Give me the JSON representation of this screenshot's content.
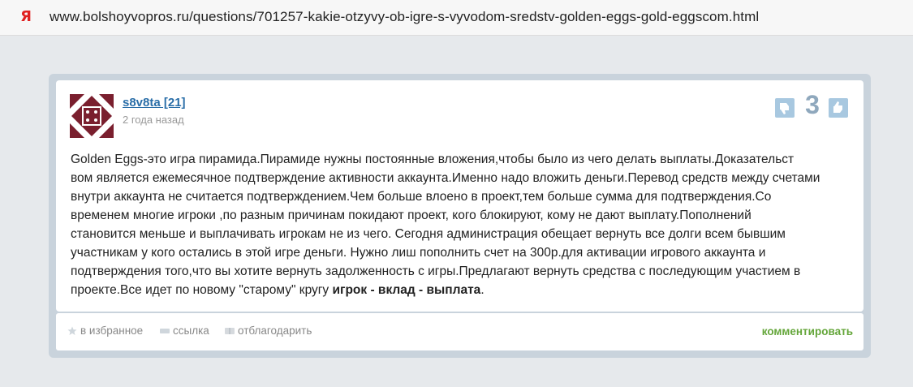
{
  "browser": {
    "url": "www.bolshoyvopros.ru/questions/701257-kakie-otzyvy-ob-igre-s-vyvodom-sredstv-golden-eggs-gold-eggscom.html",
    "favicon": "yandex-icon"
  },
  "answer": {
    "username": "s8v8ta [21]",
    "time": "2 года назад",
    "votes": "3",
    "lines": [
      "Golden Eggs-это игра пирамида.Пирамиде нужны постоянные вложения,чтобы было из чего делать выплаты.Доказательст",
      "вом является ежемесячное подтверждение активности аккаунта.Именно надо вложить деньги.Перевод средств между счетами",
      "внутри аккаунта не считается подтверждением.Чем больше влоено в проект,тем больше сумма для подтверждения.Со",
      "временем многие игроки ,по разным причинам покидают проект, кого блокируют, кому не дают выплату.Пополнений",
      "становится меньше и выплачивать игрокам не из чего. Сегодня администрация обещает вернуть все долги всем бывшим",
      "участникам у кого остались в этой игре деньги. Нужно лиш пополнить счет на 300р.для активации игрового аккаунта и",
      "подтверждения того,что вы хотите вернуть задолженность с игры.Предлагают вернуть средства с последующим участием в"
    ],
    "last_line_start": "проекте.Все идет по новому \"старому\" кругу ",
    "last_line_bold": "игрок - вклад - выплата",
    "last_line_end": "."
  },
  "actions": {
    "favorite": "в избранное",
    "link": "ссылка",
    "thank": "отблагодарить",
    "comment": "комментировать"
  },
  "colors": {
    "link_blue": "#2a6ea8",
    "comment_green": "#64a63a",
    "vote_blue": "#a8c8e0",
    "avatar_maroon": "#7a1f2e"
  }
}
